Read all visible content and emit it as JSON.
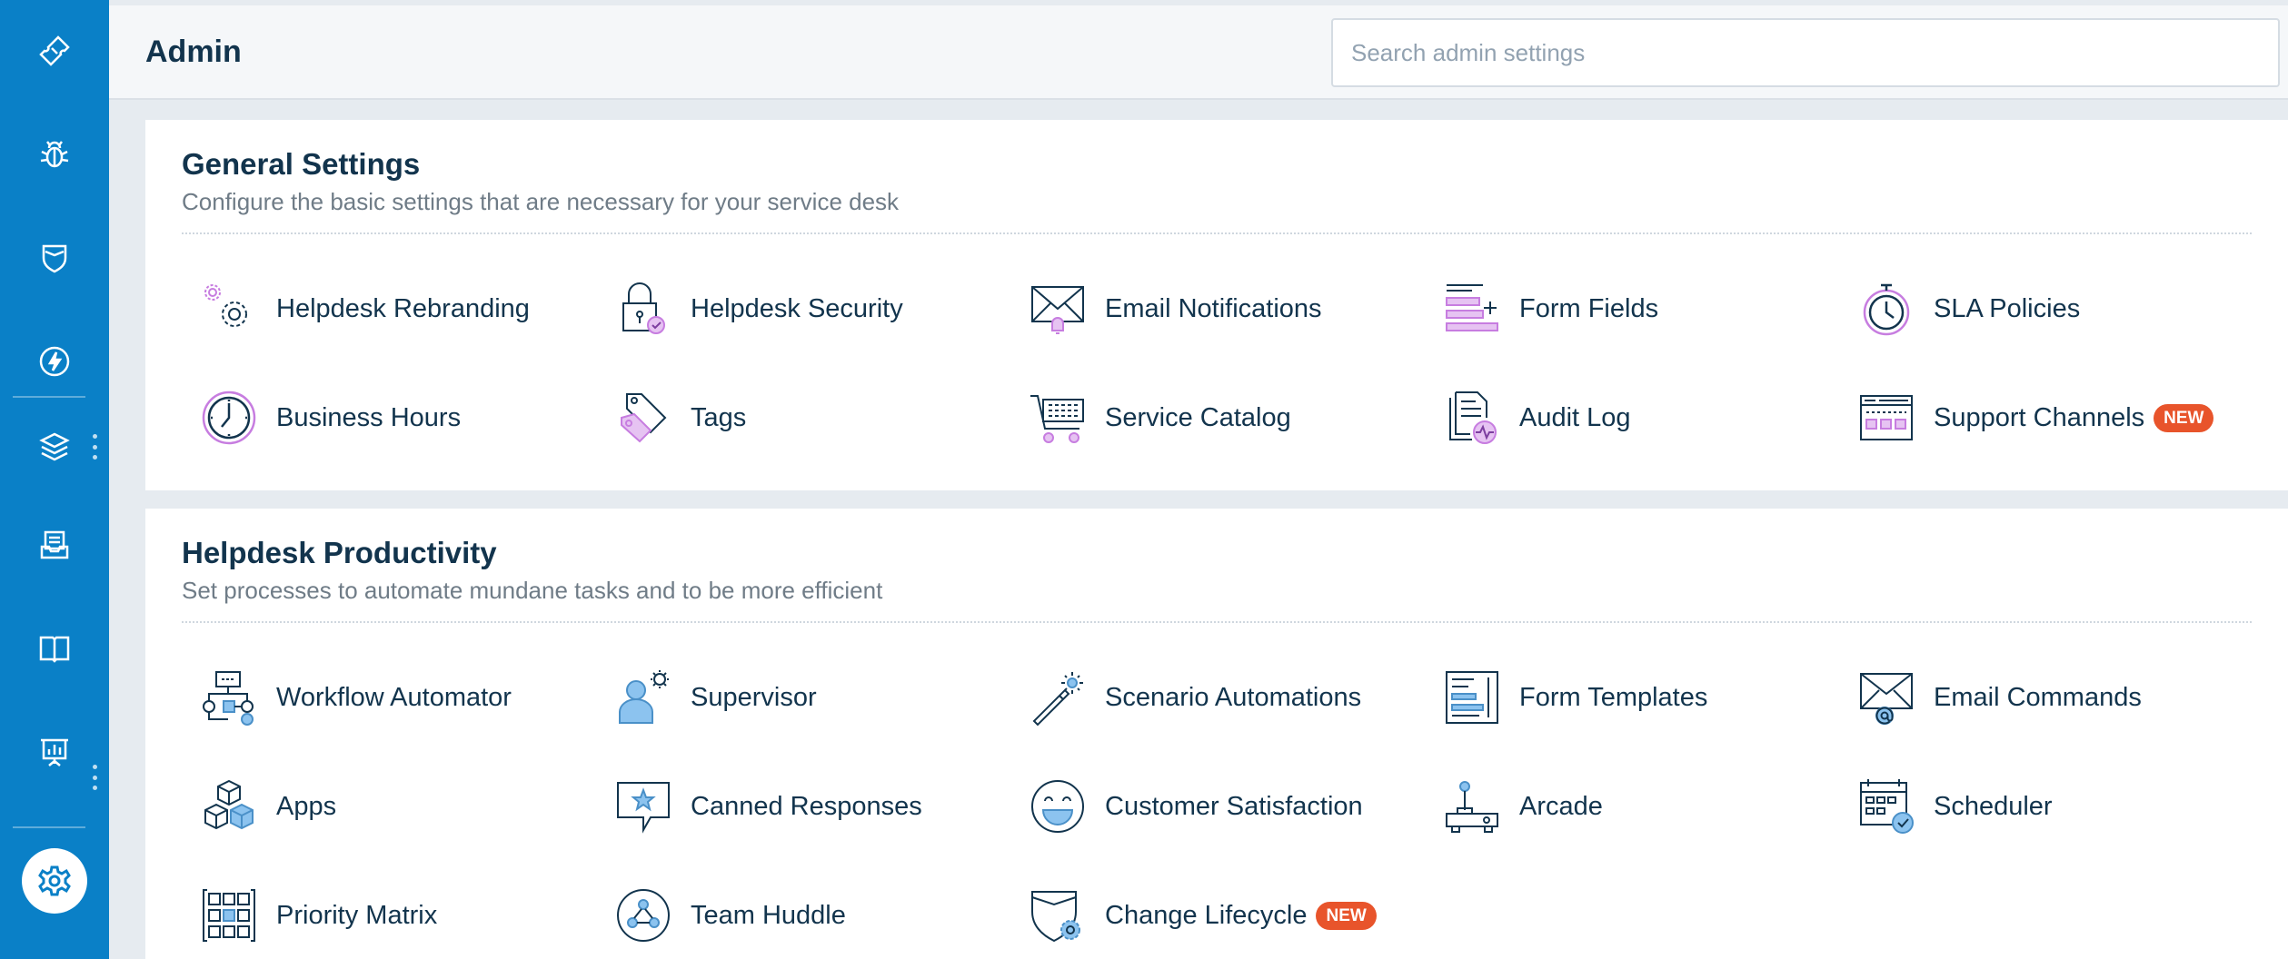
{
  "header": {
    "title": "Admin",
    "search_placeholder": "Search admin settings"
  },
  "colors": {
    "sidebar": "#0a80c7",
    "accent_purple": "#c77de0",
    "accent_blue": "#8cc3ef",
    "badge": "#e8542b",
    "text": "#12344d"
  },
  "sidebar": {
    "items": [
      {
        "icon": "ticket-icon"
      },
      {
        "icon": "bug-icon"
      },
      {
        "icon": "shield-icon"
      },
      {
        "icon": "lightning-icon"
      },
      {
        "icon": "layers-icon"
      },
      {
        "icon": "inbox-icon"
      },
      {
        "icon": "book-icon"
      },
      {
        "icon": "analytics-icon"
      },
      {
        "icon": "gear-icon",
        "active": true
      }
    ]
  },
  "general": {
    "title": "General Settings",
    "subtitle": "Configure the basic settings that are necessary for your service desk",
    "items": [
      {
        "label": "Helpdesk Rebranding",
        "icon": "gears-icon"
      },
      {
        "label": "Helpdesk Security",
        "icon": "padlock-icon"
      },
      {
        "label": "Email Notifications",
        "icon": "envelope-bell-icon"
      },
      {
        "label": "Form Fields",
        "icon": "form-fields-icon"
      },
      {
        "label": "SLA Policies",
        "icon": "stopwatch-icon"
      },
      {
        "label": "Business Hours",
        "icon": "clock-icon"
      },
      {
        "label": "Tags",
        "icon": "tags-icon"
      },
      {
        "label": "Service Catalog",
        "icon": "cart-icon"
      },
      {
        "label": "Audit Log",
        "icon": "audit-log-icon"
      },
      {
        "label": "Support Channels",
        "icon": "channels-icon",
        "badge": "NEW"
      }
    ]
  },
  "productivity": {
    "title": "Helpdesk Productivity",
    "subtitle": "Set processes to automate mundane tasks and to be more efficient",
    "items": [
      {
        "label": "Workflow Automator",
        "icon": "workflow-icon"
      },
      {
        "label": "Supervisor",
        "icon": "supervisor-icon"
      },
      {
        "label": "Scenario Automations",
        "icon": "magic-wand-icon"
      },
      {
        "label": "Form Templates",
        "icon": "form-templates-icon"
      },
      {
        "label": "Email Commands",
        "icon": "email-at-icon"
      },
      {
        "label": "Apps",
        "icon": "cubes-icon"
      },
      {
        "label": "Canned Responses",
        "icon": "speech-star-icon"
      },
      {
        "label": "Customer Satisfaction",
        "icon": "smiley-icon"
      },
      {
        "label": "Arcade",
        "icon": "joystick-icon"
      },
      {
        "label": "Scheduler",
        "icon": "calendar-check-icon"
      },
      {
        "label": "Priority Matrix",
        "icon": "matrix-grid-icon"
      },
      {
        "label": "Team Huddle",
        "icon": "team-nodes-icon"
      },
      {
        "label": "Change Lifecycle",
        "icon": "shield-gear-icon",
        "badge": "NEW"
      }
    ]
  }
}
